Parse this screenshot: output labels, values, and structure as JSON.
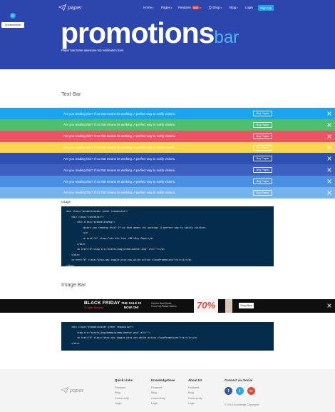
{
  "brand": {
    "name": "paper"
  },
  "nav": {
    "items": [
      {
        "label": "Home",
        "caret": "▾"
      },
      {
        "label": "Pages",
        "caret": "▾"
      },
      {
        "label": "Features",
        "badge": "NEW",
        "caret": "▾"
      },
      {
        "label": "Shop",
        "caret": "▾",
        "icon": "cart-icon"
      },
      {
        "label": "Blog",
        "caret": "▾"
      },
      {
        "label": "Login",
        "caret": ""
      }
    ],
    "signup_label": "Sign Up"
  },
  "documentation": {
    "tooltip": "Documentation",
    "icon": "book-icon"
  },
  "hero": {
    "title_main": "promotions",
    "title_sub": "bar",
    "subtitle": "Paper has some awesome top notification bars."
  },
  "text_bar_section": {
    "title": "Text Bar",
    "bars": [
      {
        "color": "#1ba5ef",
        "text": "Are you reading this? If so that means its working. A perfect way to notify visitors.",
        "button": "Buy Paper"
      },
      {
        "color": "#4fbf6e",
        "text": "Are you reading this? If so that means its working. A perfect way to notify visitors.",
        "button": "Buy Paper"
      },
      {
        "color": "#ec5466",
        "text": "Are you reading this? If so that means its working. A perfect way to notify visitors.",
        "button": "Buy Paper"
      },
      {
        "color": "#fad64d",
        "text": "Are you reading this? If so that means its working. A perfect way to notify visitors.",
        "button": "Buy Paper"
      },
      {
        "color": "#2e4fb2",
        "text": "Are you reading this? If so that means its working. A perfect way to notify visitors.",
        "button": "Buy Paper"
      },
      {
        "color": "#3d5fc0",
        "text": "Are you reading this? If so that means its working. A perfect way to notify visitors.",
        "button": "Buy Paper"
      },
      {
        "color": "#4a90e2",
        "text": "Are you reading this? If so that means its working. A perfect way to notify visitors.",
        "button": "Buy Paper"
      },
      {
        "color": "#74b3ee",
        "text": "Are you reading this? If so that means its working. A perfect way to notify visitors.",
        "button": "Buy Paper"
      }
    ],
    "usage_label": "Usage"
  },
  "code1": [
    "<div class=\"promotionsbar green responsive\">",
    "    <div class=\"container\">",
    "        <div class=\"promotionsMsg\">",
    "            <p>Are you reading this? If so that means its working. A perfect way to notify visitors.",
    "            </p>",
    "            <a href=\"#\" class=\"btn btn-line <3B\">Buy Paper</a>",
    "        </div>",
    "        <a href=\"#\"><img src=\"assets/img/promo-banner.png\" alt=\"\"></a>",
    "    </div>",
    "    <a href=\"#\" class=\"ptco-nav-toggle ptco-nav-white active closePromotions\"><i></i></a>",
    "</div>"
  ],
  "image_bar_section": {
    "title": "Image Bar",
    "banner": {
      "headline": "BLACK FRIDAY",
      "subline": "& Cyber Monday",
      "sale": [
        "THE SALE IS",
        "NOW ON!"
      ],
      "deals": [
        "Get the Best Deals",
        "From Top-Rated Sellers"
      ],
      "percent": "70%",
      "shop_label": "Shop Now"
    }
  },
  "code2": [
    "    <div class=\"promotionsbar green responsive\">",
    "        <img src=\"assets/img/dummy/promo-banner.png\" alt=\"\">",
    "        <a href=\"#\" class=\"ptco-nav-toggle ptco-nav-white active closePromotions\"><i></i></a>",
    "    </div>"
  ],
  "footer": {
    "brand": "paper",
    "columns": [
      {
        "title": "Quick Links",
        "links": [
          "Features",
          "Blog",
          "Community",
          "Login"
        ]
      },
      {
        "title": "Knowledgebase",
        "links": [
          "Features",
          "Blog",
          "Community",
          "Login"
        ]
      },
      {
        "title": "About Us",
        "links": [
          "Features",
          "Blog",
          "Community",
          "Login"
        ]
      }
    ],
    "connect_title": "Connect via Social",
    "social": [
      {
        "name": "facebook",
        "glyph": "f",
        "color": "#3b5998"
      },
      {
        "name": "twitter",
        "glyph": "t",
        "color": "#2aa3ef"
      },
      {
        "name": "google-plus",
        "glyph": "G+",
        "color": "#e04b3c"
      }
    ],
    "copyright": "© 2016 Knowledge Copyrights"
  }
}
